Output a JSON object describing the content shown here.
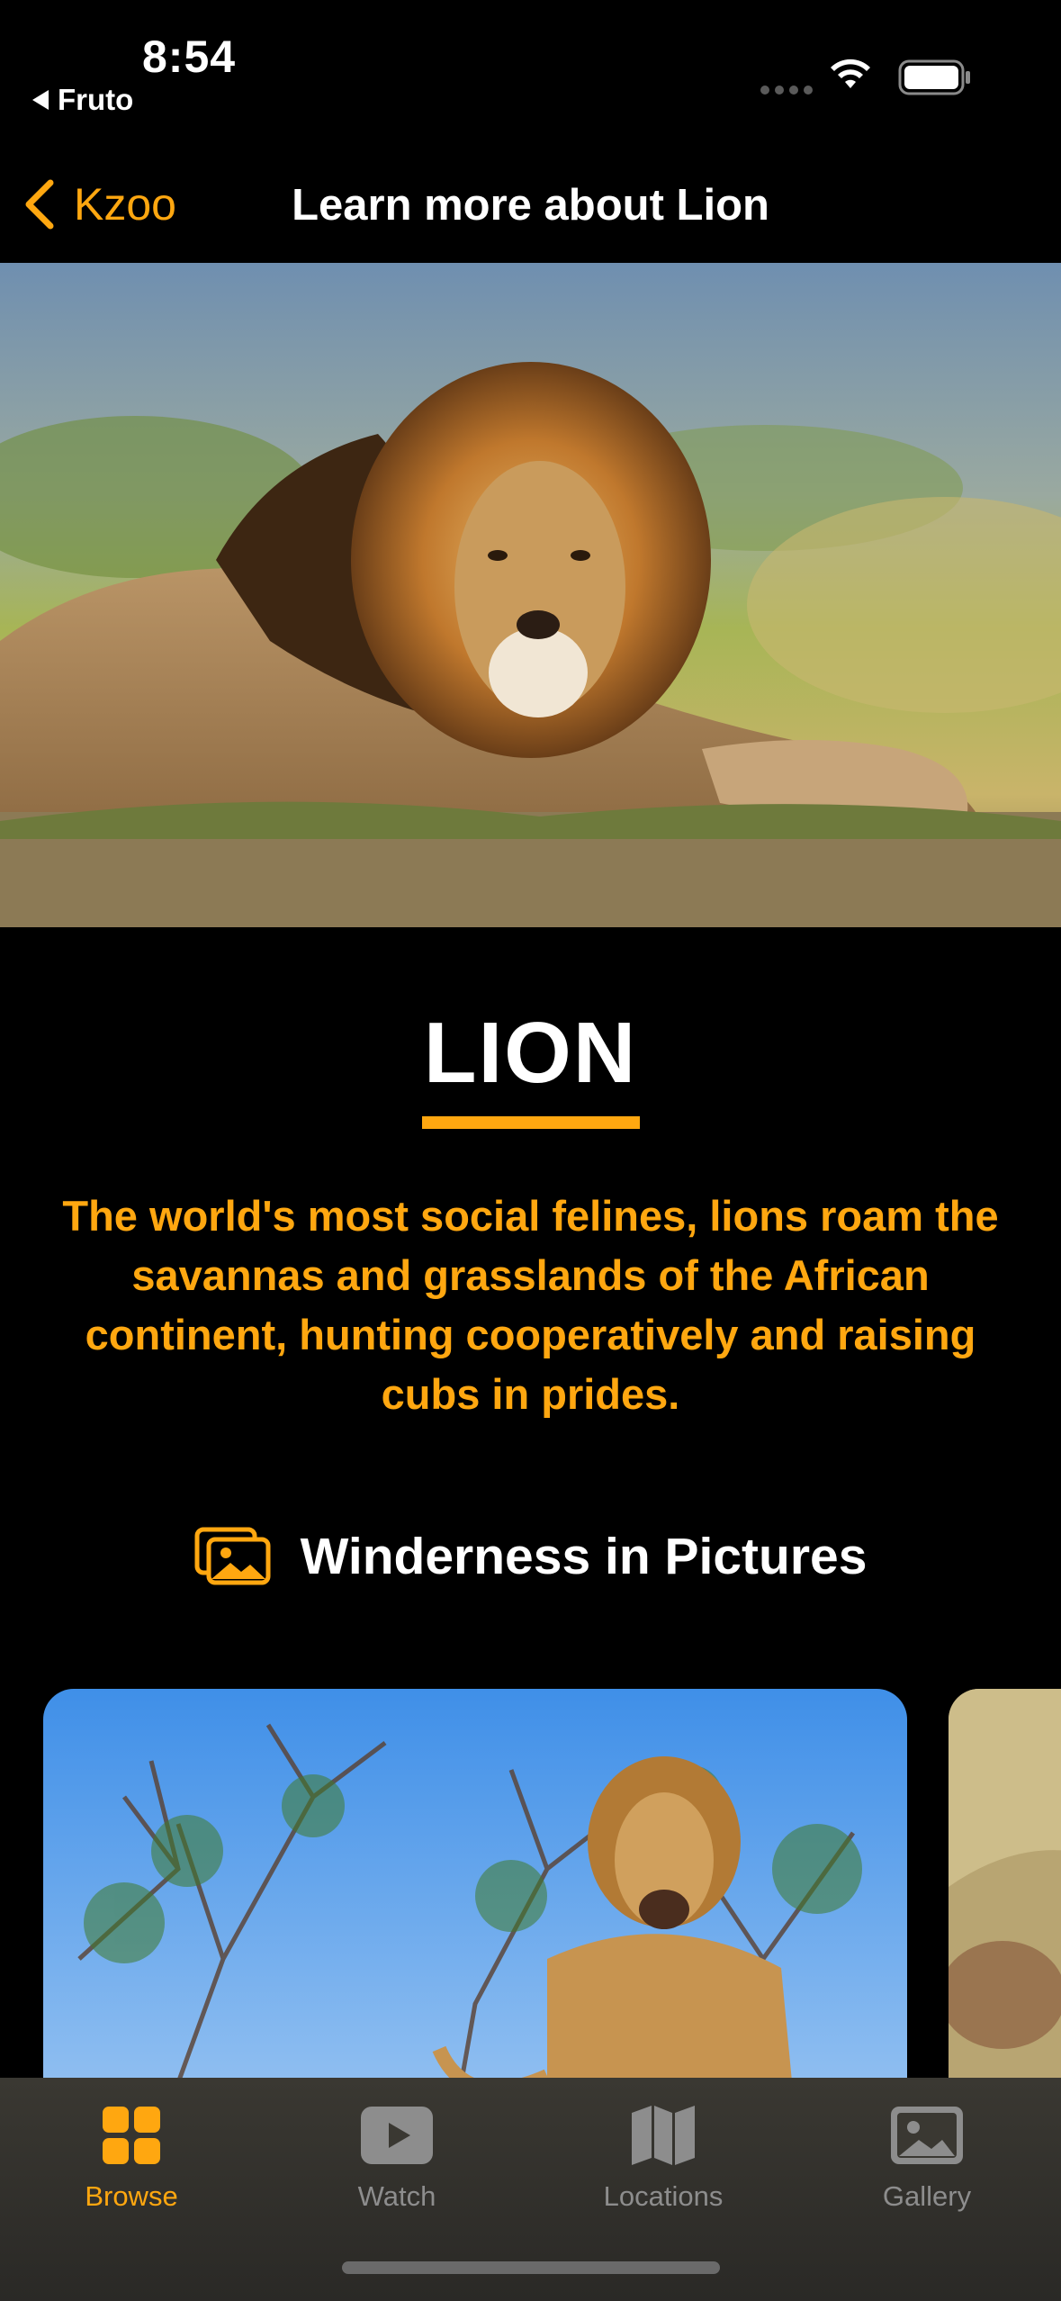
{
  "status_bar": {
    "time": "8:54",
    "back_app": "Fruto"
  },
  "nav": {
    "back_label": "Kzoo",
    "title": "Learn more about Lion"
  },
  "animal": {
    "name": "LION",
    "description": "The world's most social felines, lions roam the savannas and grasslands of the African continent, hunting cooperatively and raising cubs in prides."
  },
  "gallery_section": {
    "title": "Winderness in Pictures"
  },
  "tabs": [
    {
      "label": "Browse",
      "icon": "grid-icon",
      "active": true
    },
    {
      "label": "Watch",
      "icon": "play-icon",
      "active": false
    },
    {
      "label": "Locations",
      "icon": "map-icon",
      "active": false
    },
    {
      "label": "Gallery",
      "icon": "photo-icon",
      "active": false
    }
  ],
  "colors": {
    "accent": "#FFA710",
    "background": "#000000",
    "tabbar": "#33312d",
    "inactive": "#8d8d8d"
  }
}
